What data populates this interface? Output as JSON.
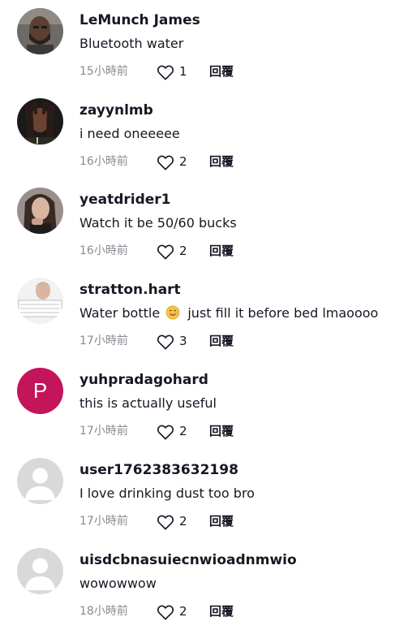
{
  "comments": [
    {
      "username": "LeMunch James",
      "text": "Bluetooth water",
      "time": "15小時前",
      "likes": "1",
      "reply": "回覆",
      "avatar": "photo-man-beard"
    },
    {
      "username": "zayynlmb",
      "text": "i need oneeeee",
      "time": "16小時前",
      "likes": "2",
      "reply": "回覆",
      "avatar": "photo-dreadlocks"
    },
    {
      "username": "yeatdrider1",
      "text": "Watch it be 50/60 bucks",
      "time": "16小時前",
      "likes": "2",
      "reply": "回覆",
      "avatar": "photo-woman"
    },
    {
      "username": "stratton.hart",
      "text_before": "Water bottle",
      "text_after": "just fill it before bed lmaoooo",
      "emoji": "smiling-face-with-tear-emoji",
      "time": "17小時前",
      "likes": "3",
      "reply": "回覆",
      "avatar": "photo-id-card"
    },
    {
      "username": "yuhpradagohard",
      "text": "this is actually useful",
      "time": "17小時前",
      "likes": "2",
      "reply": "回覆",
      "avatar": "letter-avatar",
      "avatar_letter": "P",
      "avatar_color": "#c4145a"
    },
    {
      "username": "user1762383632198",
      "text": "I love drinking dust too bro",
      "time": "17小時前",
      "likes": "2",
      "reply": "回覆",
      "avatar": "default-avatar"
    },
    {
      "username": "uisdcbnasuiecnwioadnmwio",
      "text": "wowowwow",
      "time": "18小時前",
      "likes": "2",
      "reply": "回覆",
      "avatar": "default-avatar"
    }
  ],
  "colors": {
    "text_primary": "#161823",
    "text_secondary": "#8a8b91",
    "default_avatar_bg": "#d9d9d9"
  }
}
